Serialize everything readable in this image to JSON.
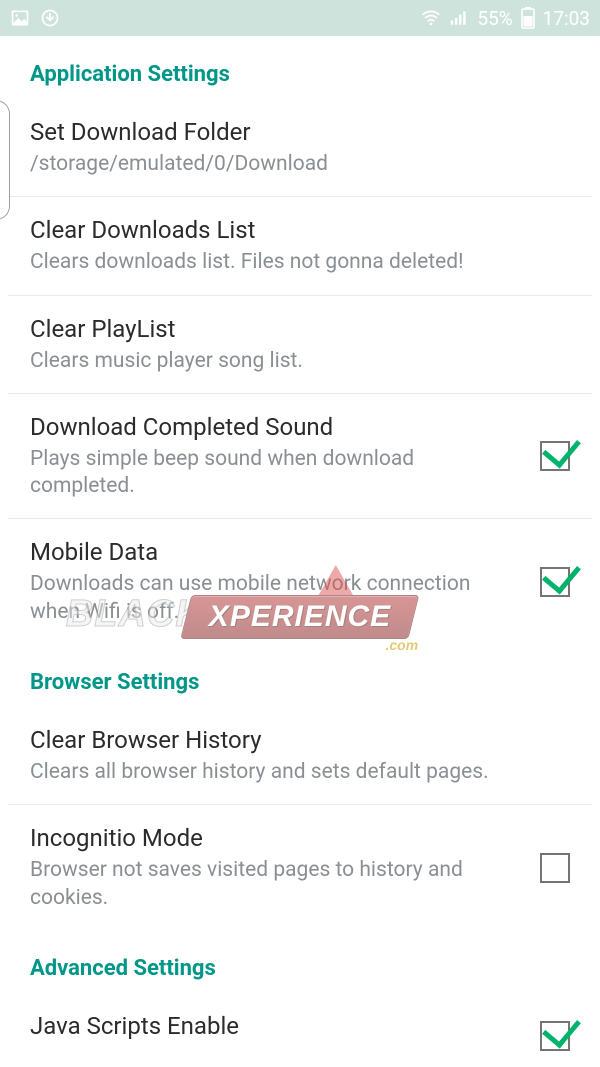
{
  "status": {
    "battery": "55%",
    "time": "17:03"
  },
  "sections": {
    "app": {
      "header": "Application Settings"
    },
    "browser": {
      "header": "Browser Settings"
    },
    "advanced": {
      "header": "Advanced Settings"
    }
  },
  "items": {
    "download_folder": {
      "title": "Set Download Folder",
      "subtitle": "/storage/emulated/0/Download"
    },
    "clear_downloads": {
      "title": "Clear Downloads List",
      "subtitle": "Clears downloads list. Files not gonna deleted!"
    },
    "clear_playlist": {
      "title": "Clear PlayList",
      "subtitle": "Clears music player song list."
    },
    "completed_sound": {
      "title": "Download Completed Sound",
      "subtitle": "Plays simple beep sound when download completed.",
      "checked": true
    },
    "mobile_data": {
      "title": "Mobile Data",
      "subtitle": "Downloads can use mobile network connection when Wifi is off.",
      "checked": true
    },
    "clear_history": {
      "title": "Clear Browser History",
      "subtitle": "Clears all browser history and sets default pages."
    },
    "incognito": {
      "title": "Incognitio Mode",
      "subtitle": "Browser not saves visited pages to history and cookies.",
      "checked": false
    },
    "javascripts": {
      "title": "Java Scripts Enable",
      "checked": true
    }
  },
  "watermark": {
    "left": "BLACK",
    "right": "XPERIENCE",
    "suffix": ".com"
  }
}
